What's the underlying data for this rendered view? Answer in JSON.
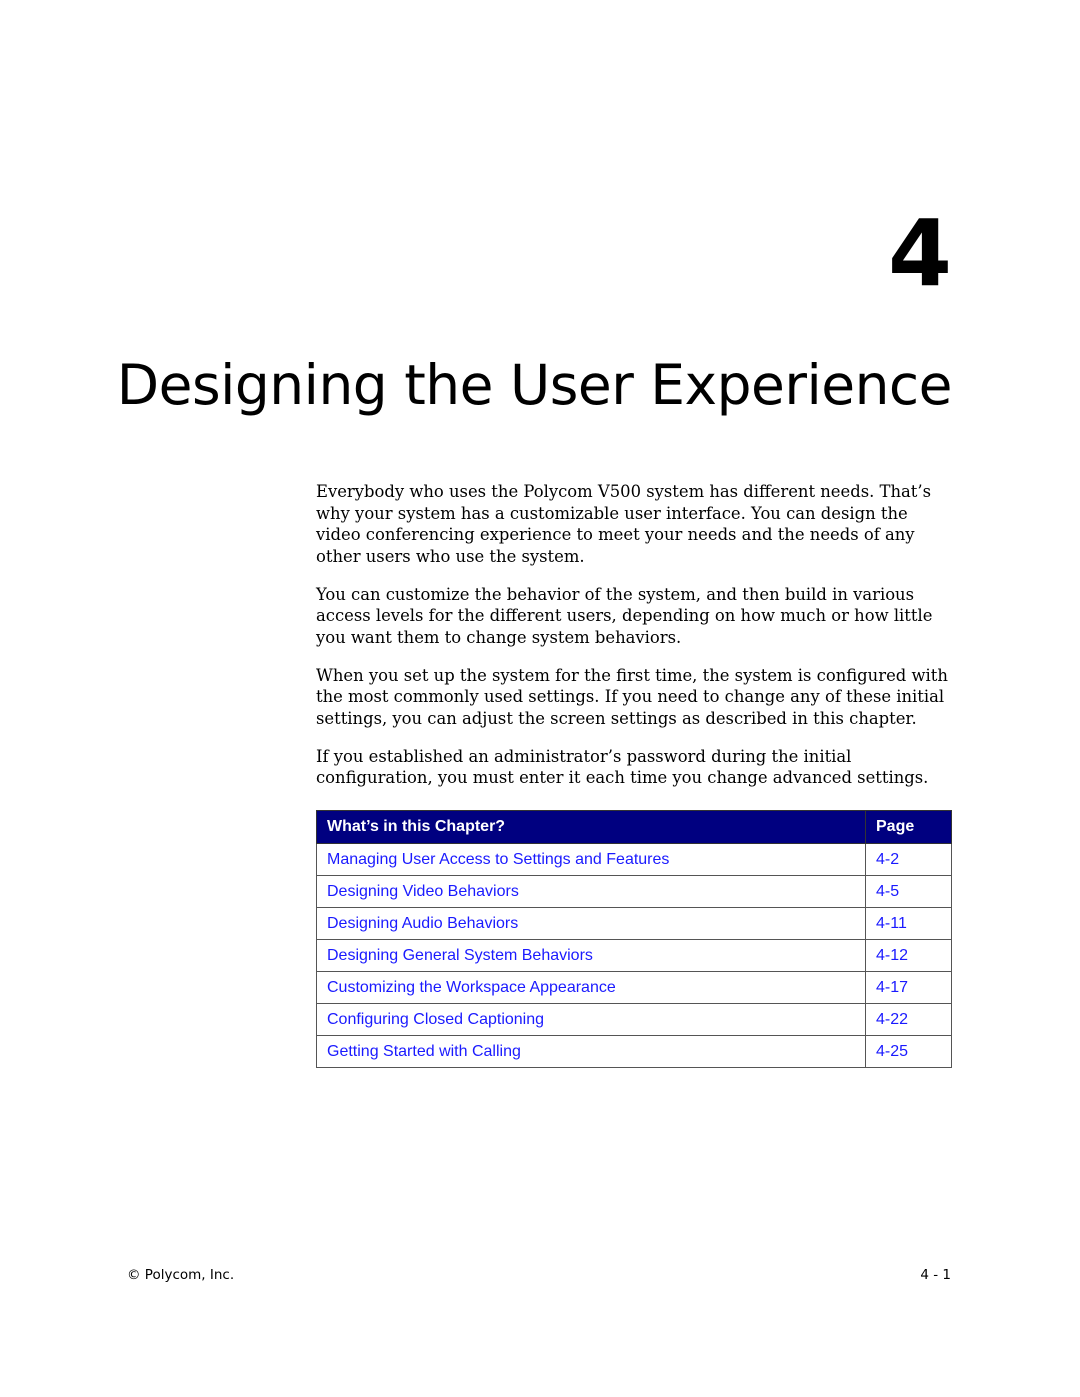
{
  "chapter": {
    "number": "4",
    "title": "Designing the User Experience"
  },
  "paragraphs": [
    "Everybody who uses the Polycom V500 system has different needs. That’s why your system has a customizable user interface. You can design the video conferencing experience to meet your needs and the needs of any other users who use the system.",
    "You can customize the behavior of the system, and then build in various access levels for the different users, depending on how much or how little you want them to change system behaviors.",
    "When you set up the system for the first time, the system is configured with the most commonly used settings. If you need to change any of these initial settings, you can adjust the screen settings as described in this chapter.",
    "If you established an administrator’s password during the initial configuration, you must enter it each time you change advanced settings."
  ],
  "toc": {
    "header": {
      "topic": "What’s in this Chapter?",
      "page": "Page"
    },
    "rows": [
      {
        "topic": "Managing User Access to Settings and Features",
        "page": "4-2"
      },
      {
        "topic": "Designing Video Behaviors",
        "page": "4-5"
      },
      {
        "topic": "Designing Audio Behaviors",
        "page": "4-11"
      },
      {
        "topic": "Designing General System Behaviors",
        "page": "4-12"
      },
      {
        "topic": "Customizing the Workspace Appearance",
        "page": "4-17"
      },
      {
        "topic": "Configuring Closed Captioning",
        "page": "4-22"
      },
      {
        "topic": "Getting Started with Calling",
        "page": "4-25"
      }
    ],
    "colors": {
      "header_bg": "#000080",
      "link": "#1a1aff"
    }
  },
  "footer": {
    "copyright": "© Polycom, Inc.",
    "page_number": "4 - 1"
  }
}
